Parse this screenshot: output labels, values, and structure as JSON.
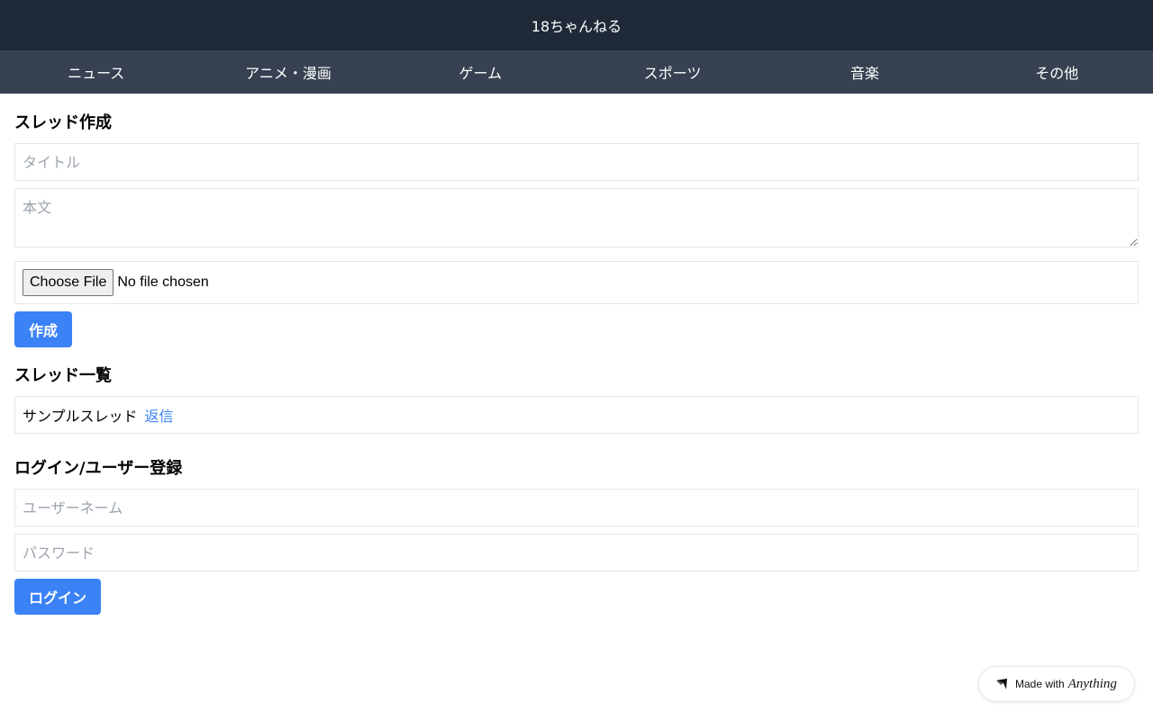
{
  "header": {
    "title": "18ちゃんねる"
  },
  "nav": {
    "items": [
      "ニュース",
      "アニメ・漫画",
      "ゲーム",
      "スポーツ",
      "音楽",
      "その他"
    ]
  },
  "create_thread": {
    "heading": "スレッド作成",
    "title_placeholder": "タイトル",
    "body_placeholder": "本文",
    "file_button": "Choose File",
    "file_status": "No file chosen",
    "submit_label": "作成"
  },
  "thread_list": {
    "heading": "スレッド一覧",
    "threads": [
      {
        "title": "サンプルスレッド",
        "reply_label": "返信"
      }
    ]
  },
  "login": {
    "heading": "ログイン/ユーザー登録",
    "username_placeholder": "ユーザーネーム",
    "password_placeholder": "パスワード",
    "submit_label": "ログイン"
  },
  "badge": {
    "prefix": "Made with",
    "brand": "Anything"
  },
  "colors": {
    "header_bg": "#1f2937",
    "nav_bg": "#374151",
    "accent": "#3b82f6",
    "border": "#e5e7eb"
  }
}
